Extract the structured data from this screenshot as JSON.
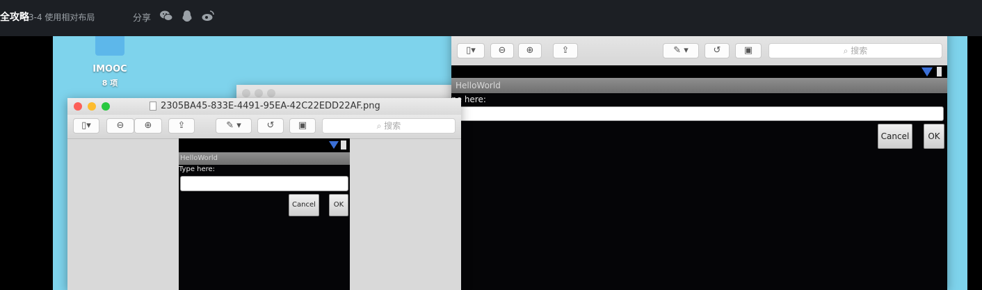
{
  "header": {
    "title": "全攻略",
    "subtitle": "3-4 使用相对布局",
    "share_label": "分享",
    "share_icons": [
      "wechat-icon",
      "qq-icon",
      "weibo-icon"
    ]
  },
  "desktop": {
    "folder_label": "IMOOC",
    "folder_count": "8 项",
    "background_color": "#7ed3ec"
  },
  "preview_window": {
    "filename": "2305BA45-833E-4491-95EA-42C22EDD22AF.png",
    "search_placeholder": "搜索",
    "toolbar_icons": [
      "sidebar-icon",
      "zoom-out-icon",
      "zoom-in-icon",
      "share-icon",
      "markup-icon",
      "rotate-icon",
      "toolbox-icon"
    ],
    "app": {
      "title": "HelloWorld",
      "prompt": "Type here:",
      "input_value": "",
      "cancel_label": "Cancel",
      "ok_label": "OK"
    }
  },
  "preview_window_large": {
    "search_placeholder": "搜索",
    "app": {
      "title": "HelloWorld",
      "prompt": "pe here:",
      "input_value": "",
      "cancel_label": "Cancel",
      "ok_label": "OK"
    }
  }
}
